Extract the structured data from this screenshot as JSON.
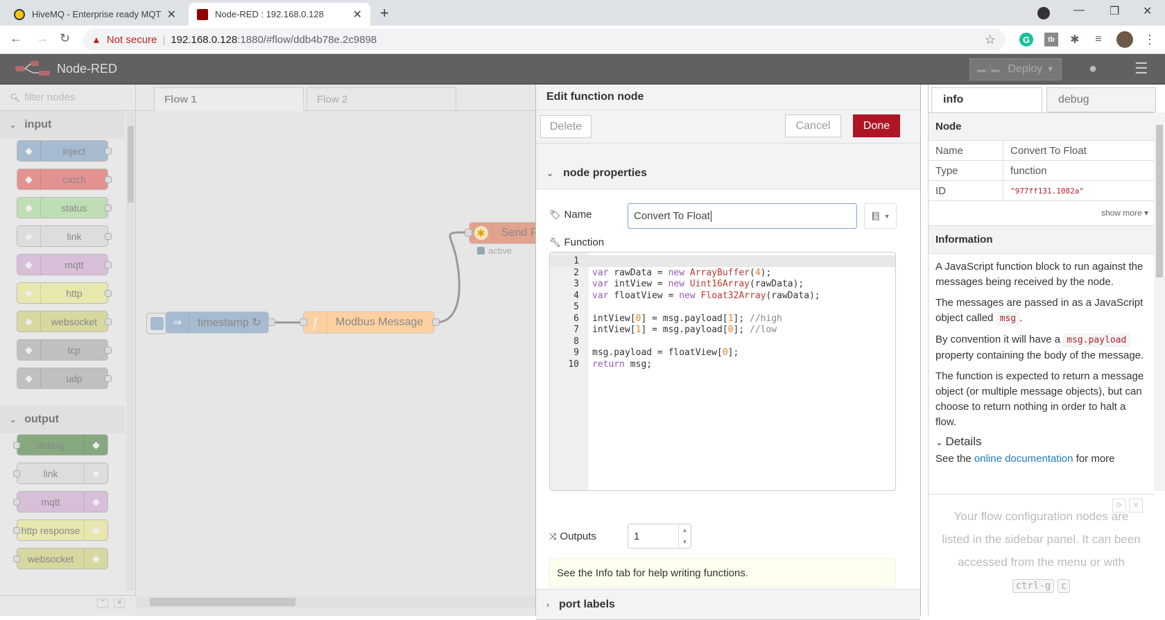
{
  "browser": {
    "tabs": [
      {
        "title": "HiveMQ - Enterprise ready MQTT",
        "active": false
      },
      {
        "title": "Node-RED : 192.168.0.128",
        "active": true
      }
    ],
    "security_label": "Not secure",
    "url_host": "192.168.0.128",
    "url_path": ":1880/#flow/ddb4b78e.2c9898"
  },
  "header": {
    "app_title": "Node-RED",
    "deploy_label": "Deploy"
  },
  "palette": {
    "filter_placeholder": "filter nodes",
    "categories": [
      {
        "name": "input",
        "nodes": [
          {
            "label": "inject",
            "color": "#a6bbcf"
          },
          {
            "label": "catch",
            "color": "#e49191"
          },
          {
            "label": "status",
            "color": "#c0deb5"
          },
          {
            "label": "link",
            "color": "#dddddd"
          },
          {
            "label": "mqtt",
            "color": "#d8bfd8"
          },
          {
            "label": "http",
            "color": "#e7e7ae"
          },
          {
            "label": "websocket",
            "color": "#d7d7a0"
          },
          {
            "label": "tcp",
            "color": "#c0c0c0"
          },
          {
            "label": "udp",
            "color": "#c0c0c0"
          }
        ]
      },
      {
        "name": "output",
        "nodes": [
          {
            "label": "debug",
            "color": "#87a980"
          },
          {
            "label": "link",
            "color": "#dddddd"
          },
          {
            "label": "mqtt",
            "color": "#d8bfd8"
          },
          {
            "label": "http response",
            "color": "#e7e7ae"
          },
          {
            "label": "websocket",
            "color": "#d7d7a0"
          }
        ]
      }
    ]
  },
  "workspace": {
    "tabs": [
      "Flow 1",
      "Flow 2"
    ],
    "nodes": {
      "timestamp": "timestamp ↻",
      "modbus": "Modbus Message",
      "send": "Send R",
      "send_status": "active"
    }
  },
  "editor": {
    "title": "Edit function node",
    "delete_label": "Delete",
    "cancel_label": "Cancel",
    "done_label": "Done",
    "section_props": "node properties",
    "name_label": "Name",
    "name_value": "Convert To Float",
    "function_label": "Function",
    "code_lines": [
      "",
      "var rawData = new ArrayBuffer(4);",
      "var intView = new Uint16Array(rawData);",
      "var floatView = new Float32Array(rawData);",
      "",
      "intView[0] = msg.payload[1]; //high",
      "intView[1] = msg.payload[0]; //low",
      "",
      "msg.payload = floatView[0];",
      "return msg;"
    ],
    "outputs_label": "Outputs",
    "outputs_value": "1",
    "tip": "See the Info tab for help writing functions.",
    "section_ports": "port labels"
  },
  "sidebar": {
    "tabs": [
      "info",
      "debug"
    ],
    "node_heading": "Node",
    "props": [
      {
        "key": "Name",
        "value": "Convert To Float"
      },
      {
        "key": "Type",
        "value": "function"
      },
      {
        "key": "ID",
        "value": "\"977ff131.1082a\""
      }
    ],
    "show_more": "show more ▾",
    "info_heading": "Information",
    "p1": "A JavaScript function block to run against the messages being received by the node.",
    "p2_pre": "The messages are passed in as a JavaScript object called ",
    "p2_code": "msg",
    "p2_post": ".",
    "p3_pre": "By convention it will have a ",
    "p3_code": "msg.payload",
    "p3_post": " property containing the body of the message.",
    "p4": "The function is expected to return a message object (or multiple message objects), but can choose to return nothing in order to halt a flow.",
    "details_label": "Details",
    "p5_pre": "See the ",
    "p5_link": "online documentation",
    "p5_post": " for more",
    "config_text": "Your flow configuration nodes are listed in the sidebar panel. It can been accessed from the menu or with",
    "config_key1": "ctrl-g",
    "config_key2": "c"
  },
  "colors": {
    "done_button": "#ad1625",
    "header_bg": "#616161",
    "code_keyword": "#9b59b6",
    "code_class": "#c0392b",
    "code_number": "#e67e22"
  }
}
